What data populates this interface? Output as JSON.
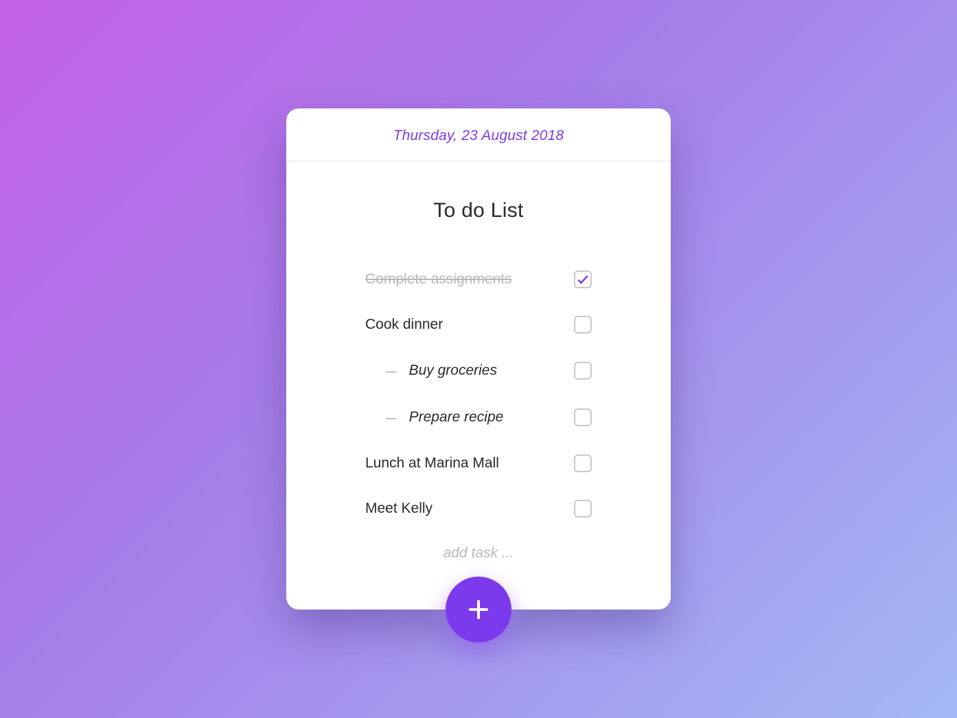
{
  "header": {
    "date": "Thursday, 23 August 2018"
  },
  "title": "To do List",
  "tasks": [
    {
      "label": "Complete assignments",
      "done": true
    },
    {
      "label": "Cook dinner",
      "done": false,
      "subtasks": [
        {
          "label": "Buy groceries",
          "done": false
        },
        {
          "label": "Prepare recipe",
          "done": false
        }
      ]
    },
    {
      "label": "Lunch at Marina Mall",
      "done": false
    },
    {
      "label": "Meet Kelly",
      "done": false
    }
  ],
  "add_task_placeholder": "add task ...",
  "colors": {
    "accent": "#7c3aed"
  }
}
